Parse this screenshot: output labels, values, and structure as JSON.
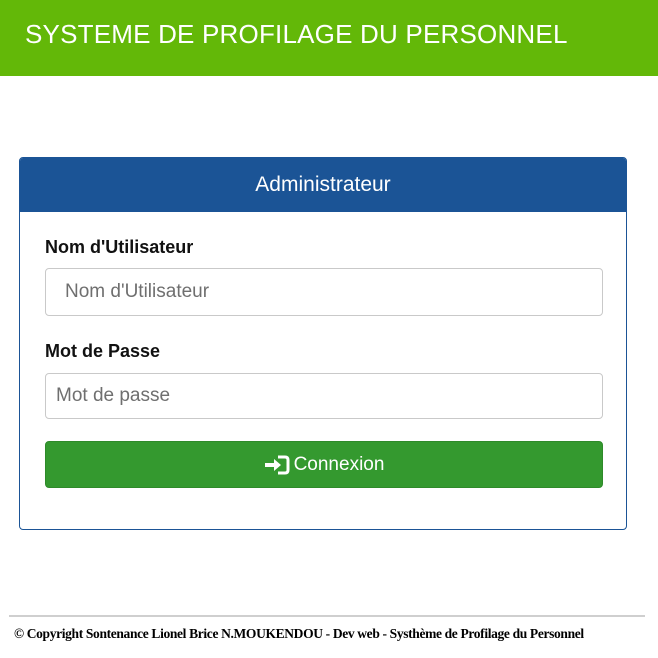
{
  "header": {
    "title": "SYSTEME DE PROFILAGE DU PERSONNEL"
  },
  "login_panel": {
    "heading": "Administrateur",
    "username": {
      "label": "Nom d'Utilisateur",
      "placeholder": "Nom d'Utilisateur",
      "value": ""
    },
    "password": {
      "label": "Mot de Passe",
      "placeholder": "Mot de passe",
      "value": ""
    },
    "submit": {
      "label": "Connexion",
      "icon": "sign-in-icon"
    }
  },
  "footer": {
    "copyright": "© Copyright Sontenance Lionel Brice N.MOUKENDOU - Dev web - Systhème de Profilage du Personnel"
  },
  "colors": {
    "header_bg": "#63b808",
    "panel_heading_bg": "#1b5496",
    "button_bg": "#34992f",
    "text_on_color": "#ffffff"
  }
}
